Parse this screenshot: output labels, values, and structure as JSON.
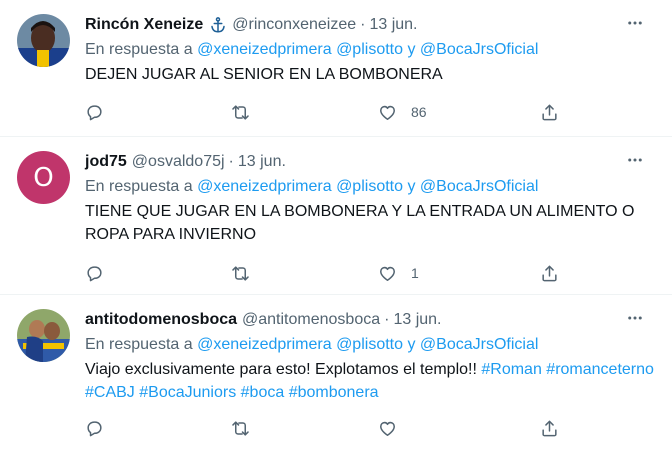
{
  "reply_prefix": "En respuesta a",
  "reply_joiner": "y",
  "tweets": [
    {
      "name": "Rincón Xeneize",
      "handle": "@rinconxeneizee",
      "date": "13 jun.",
      "mentions": [
        "@xeneizedprimera",
        "@plisotto",
        "@BocaJrsOficial"
      ],
      "text": "DEJEN JUGAR AL SENIOR EN LA BOMBONERA",
      "likes": "86"
    },
    {
      "name": "jod75",
      "handle": "@osvaldo75j",
      "date": "13 jun.",
      "avatar_letter": "O",
      "mentions": [
        "@xeneizedprimera",
        "@plisotto",
        "@BocaJrsOficial"
      ],
      "text": "TIENE QUE JUGAR EN LA BOMBONERA Y LA ENTRADA UN ALIMENTO O ROPA PARA INVIERNO",
      "likes": "1"
    },
    {
      "name": "antitodomenosboca",
      "handle": "@antitomenosboca",
      "date": "13 jun.",
      "mentions": [
        "@xeneizedprimera",
        "@plisotto",
        "@BocaJrsOficial"
      ],
      "text": "Viajo exclusivamente para esto! Explotamos el templo!!",
      "hashtags": [
        "#Roman",
        "#romanceterno",
        "#CABJ",
        "#BocaJuniors",
        "#boca",
        "#bombonera"
      ]
    }
  ],
  "colors": {
    "link": "#1d9bf0",
    "muted": "#536471",
    "avatar_purple": "#c0356b"
  },
  "icons": {
    "reply": "reply-icon",
    "retweet": "retweet-icon",
    "like": "like-icon",
    "share": "share-icon",
    "more": "more-icon",
    "anchor": "anchor-icon"
  }
}
